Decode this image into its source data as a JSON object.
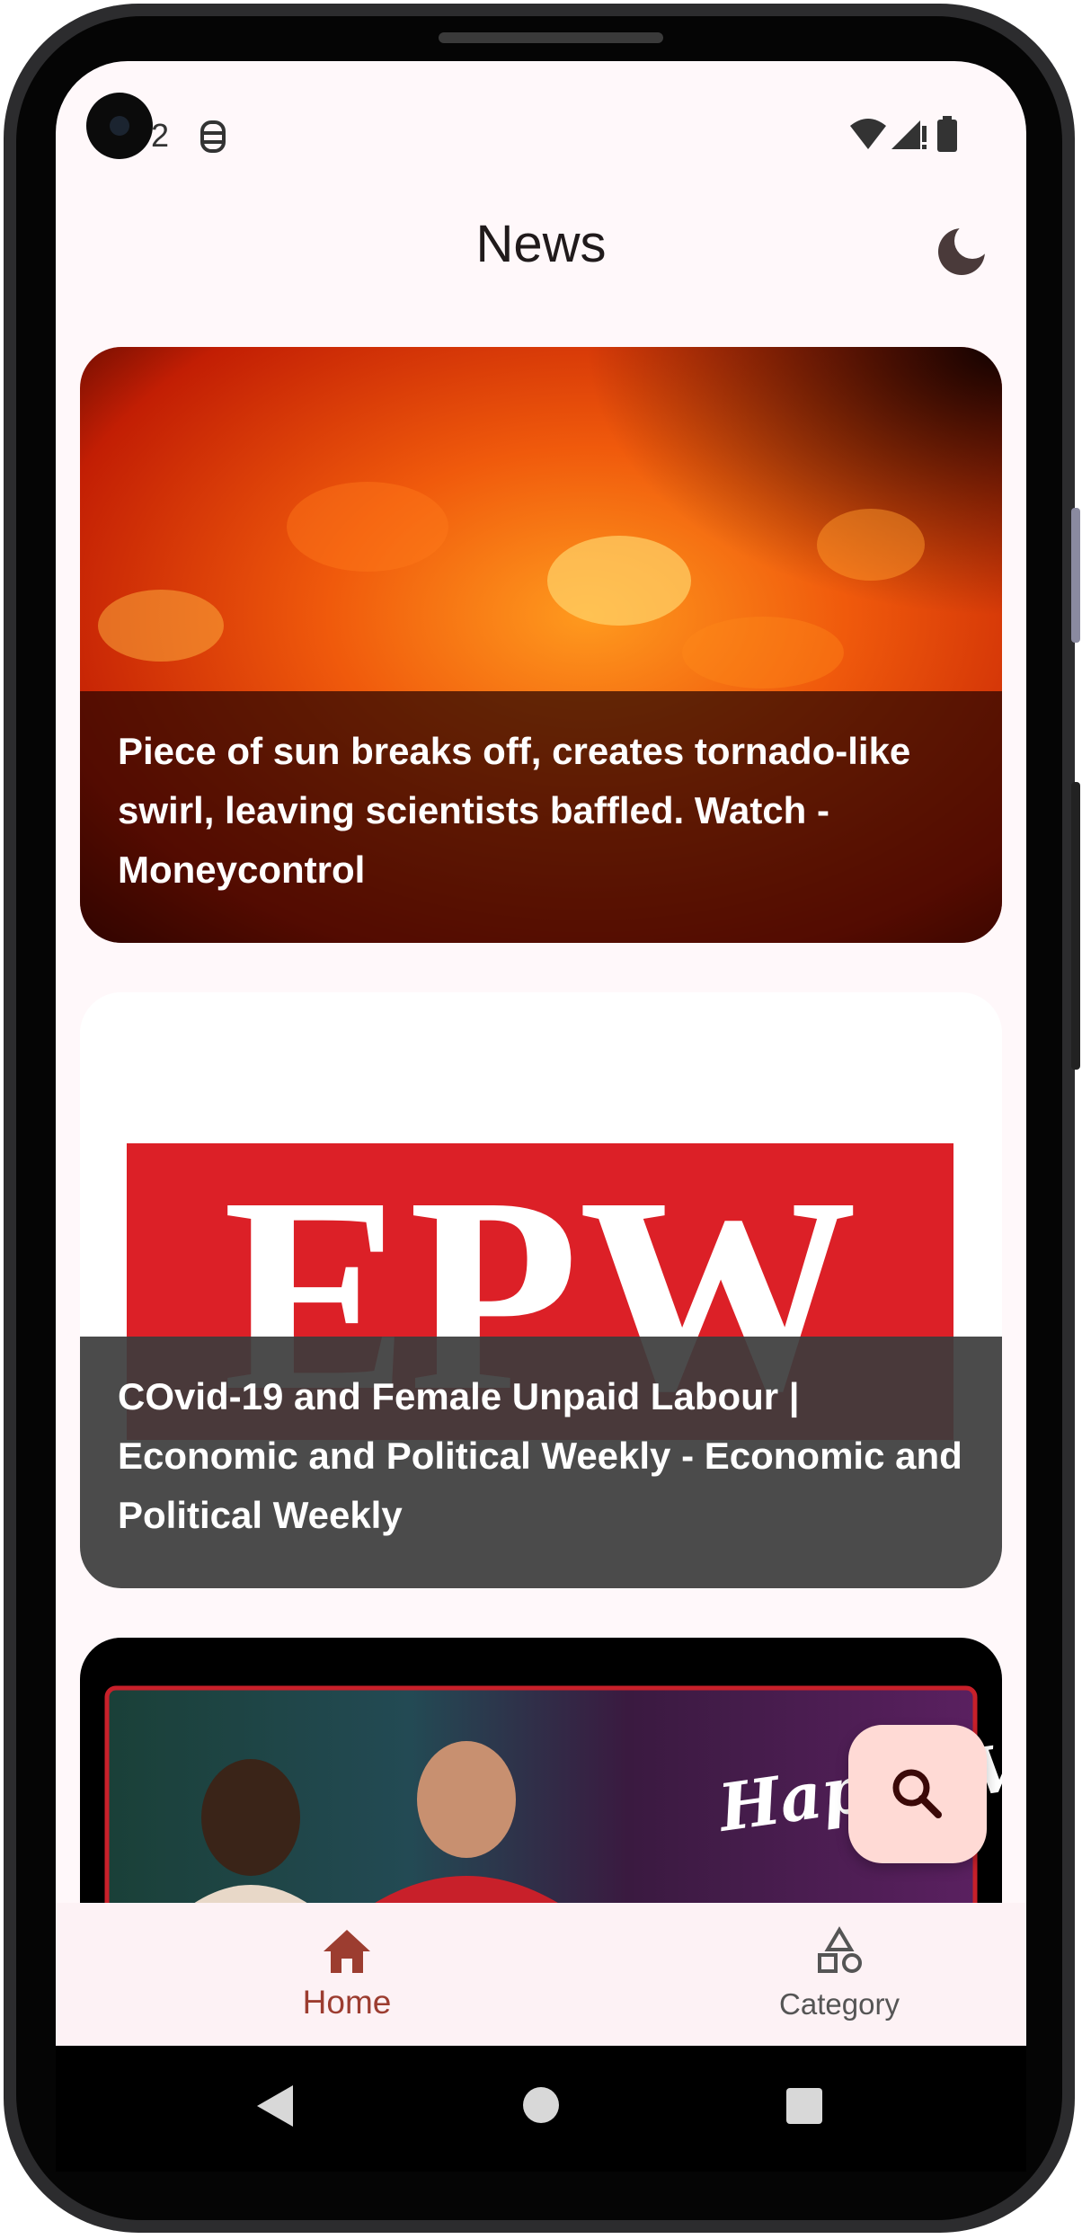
{
  "status_bar": {
    "time_fragment": "2",
    "icons": [
      "notification-icon",
      "wifi-icon",
      "signal-icon",
      "battery-icon"
    ]
  },
  "app_bar": {
    "title": "News",
    "theme_toggle_icon": "moon-icon"
  },
  "articles": [
    {
      "title": "Piece of sun breaks off, creates tornado-like swirl, leaving scientists baffled. Watch - Moneycontrol",
      "image": "sun-surface-image"
    },
    {
      "title": "COvid-19 and Female Unpaid Labour | Economic and Political Weekly - Economic and Political Weekly",
      "image": "epw-logo-image",
      "logo_text": "EPW"
    },
    {
      "title": "",
      "image": "valentines-day-game-banner",
      "banner_text": "Happy Valentine's Day"
    }
  ],
  "fab": {
    "icon": "search-icon"
  },
  "bottom_nav": {
    "items": [
      {
        "label": "Home",
        "icon": "home-icon",
        "selected": true
      },
      {
        "label": "Category",
        "icon": "category-icon",
        "selected": false
      }
    ]
  },
  "colors": {
    "primary": "#9c3d30",
    "surface": "#fff8fa",
    "nav_surface": "#fdf2f5",
    "fab": "#ffdad5",
    "on_surface": "#201a1b"
  }
}
